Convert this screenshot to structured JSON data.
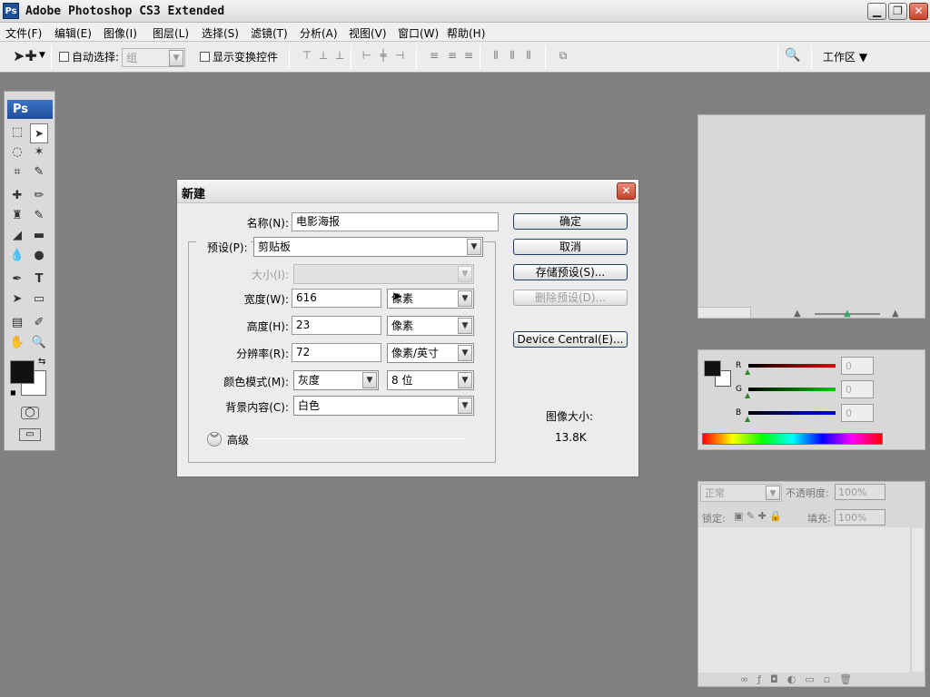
{
  "window": {
    "title": "Adobe Photoshop CS3 Extended",
    "logo": "Ps"
  },
  "menu": [
    "文件(F)",
    "编辑(E)",
    "图像(I)",
    "图层(L)",
    "选择(S)",
    "滤镜(T)",
    "分析(A)",
    "视图(V)",
    "窗口(W)",
    "帮助(H)"
  ],
  "options": {
    "auto_select": "自动选择:",
    "group_value": "组",
    "show_transform": "显示变换控件",
    "workspace": "工作区 ▼"
  },
  "toolbox": {
    "badge": "Ps"
  },
  "color_panel": {
    "r_label": "R",
    "g_label": "G",
    "b_label": "B",
    "r": "0",
    "g": "0",
    "b": "0"
  },
  "layers_panel": {
    "blend": "正常",
    "opacity_label": "不透明度:",
    "opacity": "100%",
    "lock_label": "锁定:",
    "fill_label": "填充:",
    "fill": "100%"
  },
  "dialog": {
    "title": "新建",
    "name_label": "名称(N):",
    "name_value": "电影海报",
    "preset_label": "预设(P):",
    "preset_value": "剪贴板",
    "size_label": "大小(I):",
    "size_value": "",
    "width_label": "宽度(W):",
    "width_value": "616",
    "width_unit": "像素",
    "height_label": "高度(H):",
    "height_value": "23",
    "height_unit": "像素",
    "res_label": "分辨率(R):",
    "res_value": "72",
    "res_unit": "像素/英寸",
    "mode_label": "颜色模式(M):",
    "mode_value": "灰度",
    "depth_value": "8 位",
    "bg_label": "背景内容(C):",
    "bg_value": "白色",
    "advanced_label": "高级",
    "btn_ok": "确定",
    "btn_cancel": "取消",
    "btn_save": "存储预设(S)...",
    "btn_delete": "删除预设(D)...",
    "btn_device": "Device Central(E)...",
    "image_size_label": "图像大小:",
    "image_size_value": "13.8K"
  },
  "colors": {
    "accent": "#1f4e99",
    "dialog_bg": "#ececec",
    "workspace_bg": "#808080"
  }
}
